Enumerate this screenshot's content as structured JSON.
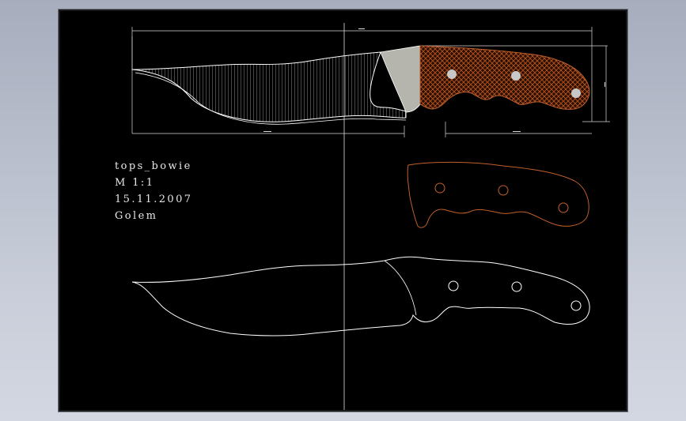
{
  "title_block": {
    "name": "tops_bowie",
    "scale": "M  1:1",
    "date": "15.11.2007",
    "author": "Golem"
  },
  "colors": {
    "sheet": "#000000",
    "line": "#ffffff",
    "handle_hatch": "#b8541f",
    "handle_outline": "#c0602a",
    "guard": "#b5b5ae",
    "dimension": "#d9d9d9"
  }
}
